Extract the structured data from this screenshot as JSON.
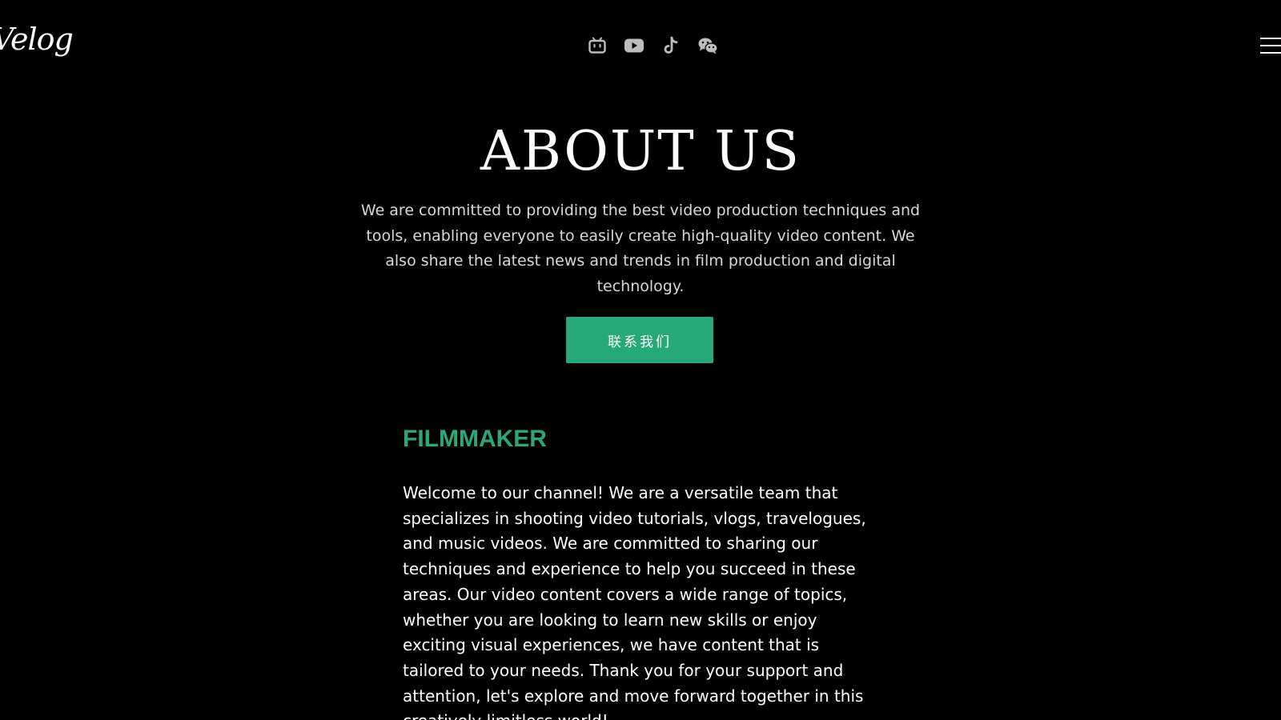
{
  "header": {
    "logo": "Velog",
    "social": [
      {
        "icon": "bilibili-icon"
      },
      {
        "icon": "youtube-icon"
      },
      {
        "icon": "tiktok-icon"
      },
      {
        "icon": "wechat-icon"
      }
    ],
    "menu_icon": "hamburger-menu-icon"
  },
  "hero": {
    "title": "ABOUT US",
    "description": "We are committed to providing the best video production techniques and tools, enabling everyone to easily create high-quality video content. We also share the latest news and trends in film production and digital technology.",
    "cta_label": "联系我们"
  },
  "section": {
    "title": "FILMMAKER",
    "body": "Welcome to our channel! We are a versatile team that specializes in shooting video tutorials, vlogs, travelogues, and music videos. We are committed to sharing our techniques and experience to help you succeed in these areas. Our video content covers a wide range of topics, whether you are looking to learn new skills or enjoy exciting visual experiences, we have content that is tailored to your needs. Thank you for your support and attention, let's explore and move forward together in this creatively limitless world!"
  },
  "colors": {
    "background": "#000000",
    "accent": "#26a878",
    "icon": "#bdbdbd",
    "text": "#ffffff"
  }
}
